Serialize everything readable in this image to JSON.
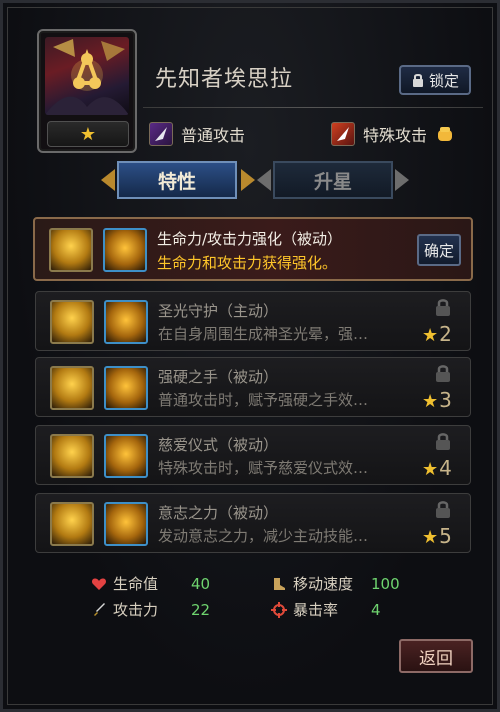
{
  "hero": {
    "name": "先知者埃思拉",
    "stars_icon": "★",
    "lock_label": "锁定"
  },
  "attacks": {
    "normal_label": "普通攻击",
    "special_label": "特殊攻击"
  },
  "tabs": [
    {
      "label": "特性",
      "active": true
    },
    {
      "label": "升星",
      "active": false
    }
  ],
  "skills": [
    {
      "title": "生命力/攻击力强化（被动）",
      "desc": "生命力和攻击力获得强化。",
      "button": "确定",
      "locked": false
    },
    {
      "title": "圣光守护（主动）",
      "desc": "在自身周围生成神圣光晕，强…",
      "required_stars": "2",
      "locked": true
    },
    {
      "title": "强硬之手（被动）",
      "desc": "普通攻击时，赋予强硬之手效…",
      "required_stars": "3",
      "locked": true
    },
    {
      "title": "慈爱仪式（被动）",
      "desc": "特殊攻击时，赋予慈爱仪式效…",
      "required_stars": "4",
      "locked": true
    },
    {
      "title": "意志之力（被动）",
      "desc": "发动意志之力，减少主动技能…",
      "required_stars": "5",
      "locked": true
    }
  ],
  "stats": [
    {
      "label": "生命值",
      "value": "40",
      "icon": "heart-icon"
    },
    {
      "label": "移动速度",
      "value": "100",
      "icon": "boots-icon"
    },
    {
      "label": "攻击力",
      "value": "22",
      "icon": "sword-icon"
    },
    {
      "label": "暴击率",
      "value": "4",
      "icon": "crosshair-icon"
    }
  ],
  "return_label": "返回",
  "colors": {
    "accent_gold": "#ffc62a",
    "stat_value": "#6fd46f",
    "tab_active": "#2c4f86"
  }
}
